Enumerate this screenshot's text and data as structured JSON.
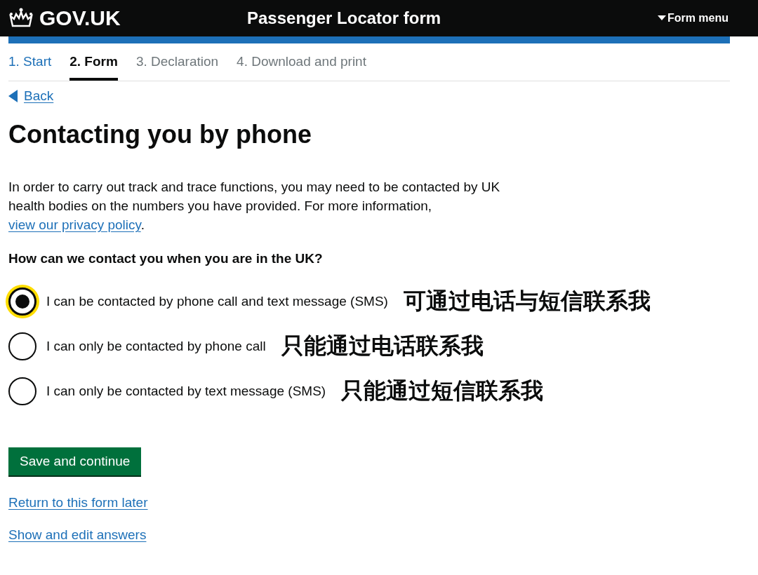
{
  "header": {
    "logo": "GOV.UK",
    "title": "Passenger Locator form",
    "menu": "Form menu"
  },
  "steps": [
    {
      "label": "1. Start",
      "selected": false,
      "completed": true
    },
    {
      "label": "2. Form",
      "selected": true,
      "completed": false
    },
    {
      "label": "3. Declaration",
      "selected": false,
      "completed": false
    },
    {
      "label": "4. Download and print",
      "selected": false,
      "completed": false
    }
  ],
  "back_link": "Back",
  "heading": "Contacting you by phone",
  "intro": {
    "text": "In order to carry out track and trace functions, you may need to be contacted by UK health bodies on the numbers you have provided. For more information, ",
    "link": "view our privacy policy",
    "after": "."
  },
  "question": "How can we contact you when you are in the UK?",
  "options": [
    {
      "label": "I can be contacted by phone call and text message (SMS)",
      "selected": true,
      "focused": true,
      "annotation": "可通过电话与短信联系我"
    },
    {
      "label": "I can only be contacted by phone call",
      "selected": false,
      "focused": false,
      "annotation": "只能通过电话联系我"
    },
    {
      "label": "I can only be contacted by text message (SMS)",
      "selected": false,
      "focused": false,
      "annotation": "只能通过短信联系我"
    }
  ],
  "primary_button": "Save and continue",
  "links": [
    "Return to this form later",
    "Show and edit answers"
  ]
}
